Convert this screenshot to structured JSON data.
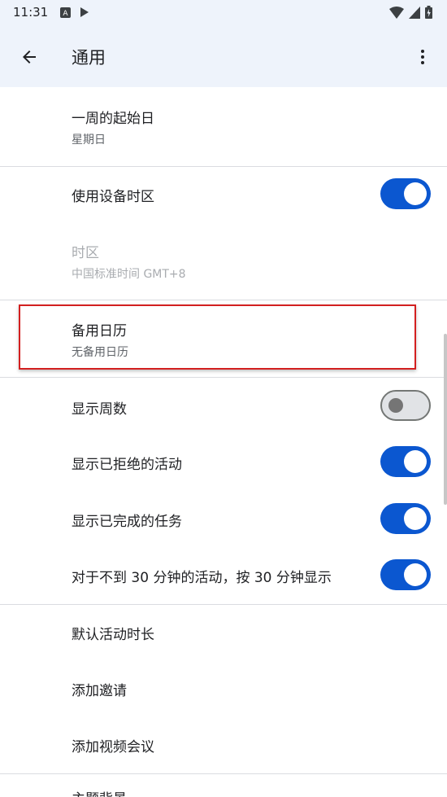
{
  "status_bar": {
    "time": "11:31"
  },
  "app_bar": {
    "title": "通用"
  },
  "settings": {
    "week_start": {
      "label": "一周的起始日",
      "value": "星期日"
    },
    "use_device_timezone": {
      "label": "使用设备时区",
      "enabled": true
    },
    "timezone": {
      "label": "时区",
      "value": "中国标准时间  GMT+8"
    },
    "alternate_calendar": {
      "label": "备用日历",
      "value": "无备用日历"
    },
    "show_week_numbers": {
      "label": "显示周数",
      "enabled": false
    },
    "show_declined_events": {
      "label": "显示已拒绝的活动",
      "enabled": true
    },
    "show_completed_tasks": {
      "label": "显示已完成的任务",
      "enabled": true
    },
    "short_events": {
      "label": "对于不到 30 分钟的活动，按 30 分钟显示",
      "enabled": true
    },
    "default_event_duration": {
      "label": "默认活动时长"
    },
    "add_invitations": {
      "label": "添加邀请"
    },
    "add_video_conferencing": {
      "label": "添加视频会议"
    },
    "theme_partial": {
      "label": "主题背景"
    }
  }
}
